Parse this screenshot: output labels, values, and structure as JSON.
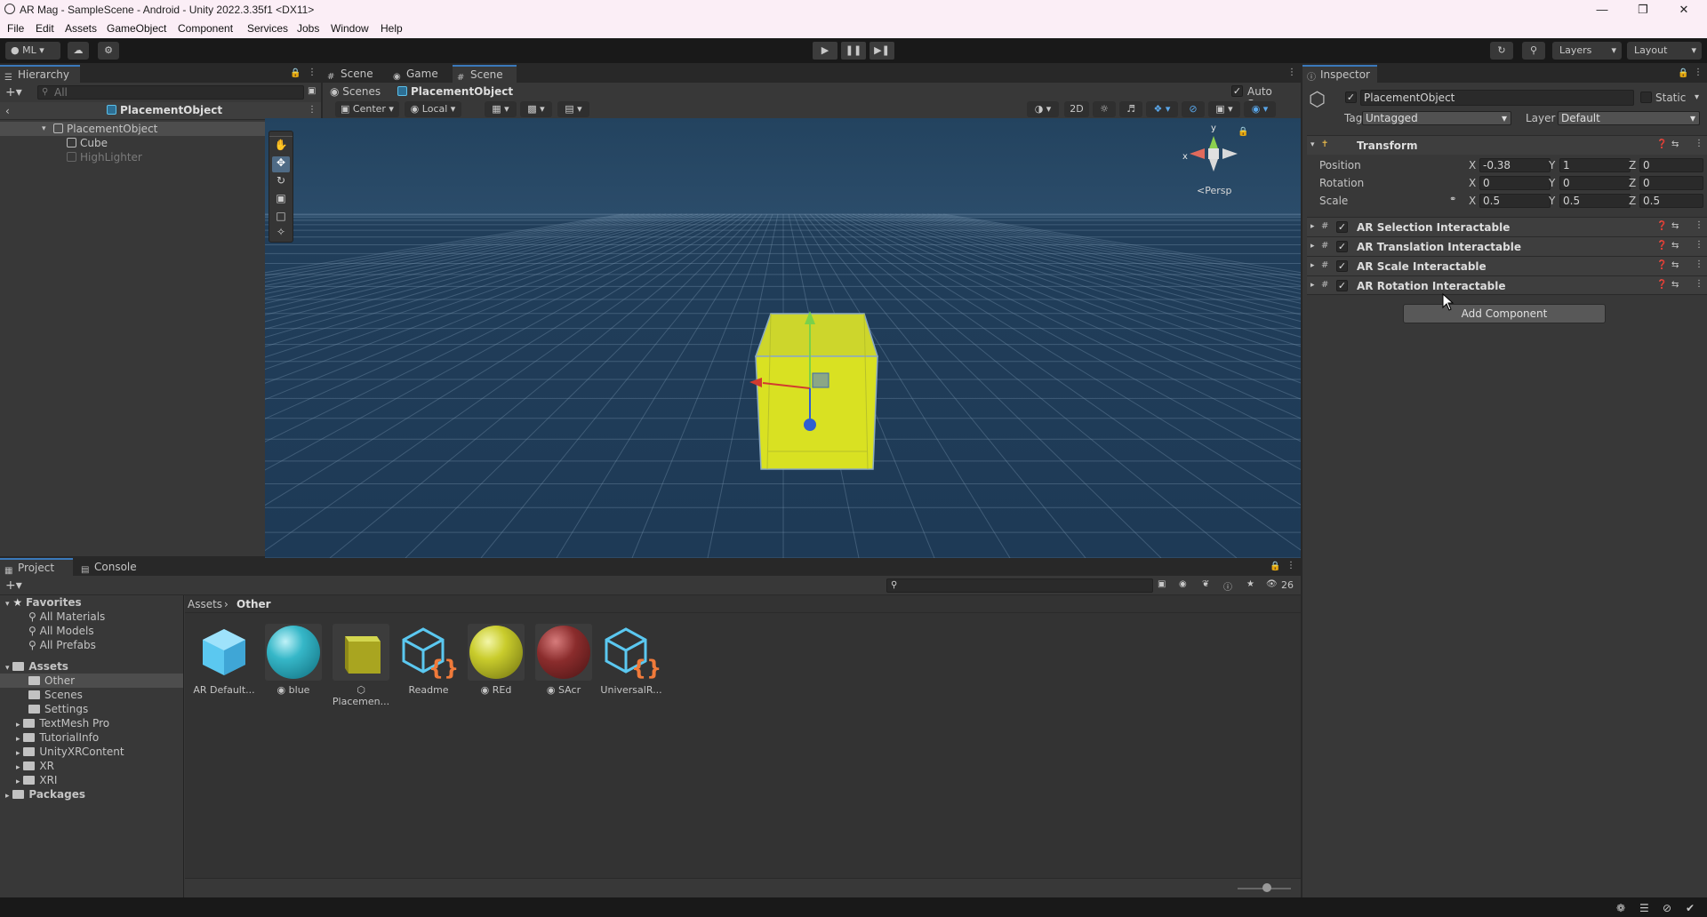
{
  "window": {
    "title": "AR Mag - SampleScene - Android - Unity 2022.3.35f1 <DX11>"
  },
  "menu": [
    "File",
    "Edit",
    "Assets",
    "GameObject",
    "Component",
    "Services",
    "Jobs",
    "Window",
    "Help"
  ],
  "toolbar": {
    "account": "ML",
    "layers": "Layers",
    "layout": "Layout"
  },
  "hierarchy": {
    "tab": "Hierarchy",
    "search_placeholder": "All",
    "context_title": "PlacementObject",
    "items": [
      {
        "label": "PlacementObject"
      },
      {
        "label": "Cube"
      },
      {
        "label": "HighLighter"
      }
    ]
  },
  "scene": {
    "tabs": [
      "Scene",
      "Game",
      "Scene"
    ],
    "breadcrumb_root": "Scenes",
    "breadcrumb_current": "PlacementObject",
    "auto_save": "Auto Save",
    "pivot": "Center",
    "space": "Local",
    "mode_2d": "2D",
    "persp": "Persp",
    "gizmo_x": "x",
    "gizmo_y": "y"
  },
  "inspector": {
    "tab": "Inspector",
    "object_name": "PlacementObject",
    "static_label": "Static",
    "tag_label": "Tag",
    "tag_value": "Untagged",
    "layer_label": "Layer",
    "layer_value": "Default",
    "transform": {
      "title": "Transform",
      "position_label": "Position",
      "rotation_label": "Rotation",
      "scale_label": "Scale",
      "position": {
        "x": "-0.38",
        "y": "1",
        "z": "0"
      },
      "rotation": {
        "x": "0",
        "y": "0",
        "z": "0"
      },
      "scale": {
        "x": "0.5",
        "y": "0.5",
        "z": "0.5"
      },
      "axis_x": "X",
      "axis_y": "Y",
      "axis_z": "Z"
    },
    "components": [
      {
        "title": "AR Selection Interactable"
      },
      {
        "title": "AR Translation Interactable"
      },
      {
        "title": "AR Scale Interactable"
      },
      {
        "title": "AR Rotation Interactable"
      }
    ],
    "add_component": "Add Component"
  },
  "project": {
    "tabs": [
      "Project",
      "Console"
    ],
    "favorites_label": "Favorites",
    "favorites": [
      "All Materials",
      "All Models",
      "All Prefabs"
    ],
    "assets_label": "Assets",
    "folders": [
      "Other",
      "Scenes",
      "Settings",
      "TextMesh Pro",
      "TutorialInfo",
      "UnityXRContent",
      "XR",
      "XRI"
    ],
    "packages_label": "Packages",
    "breadcrumb": [
      "Assets",
      "Other"
    ],
    "hidden_count": "26",
    "assets": [
      {
        "name": "AR Default...",
        "kind": "prefab-icon"
      },
      {
        "name": "blue",
        "kind": "material",
        "color": "#36b7c8"
      },
      {
        "name": "Placemen...",
        "kind": "prefab-yellow"
      },
      {
        "name": "Readme",
        "kind": "script-icon"
      },
      {
        "name": "REd",
        "kind": "material",
        "color": "#c9cc2c"
      },
      {
        "name": "SAcr",
        "kind": "material",
        "color": "#8a2c2c"
      },
      {
        "name": "UniversalR...",
        "kind": "script-icon"
      }
    ]
  },
  "colors": {
    "accent": "#3a79bb",
    "scene_bg": "#1f3a55",
    "cube": "#d7e02a"
  }
}
